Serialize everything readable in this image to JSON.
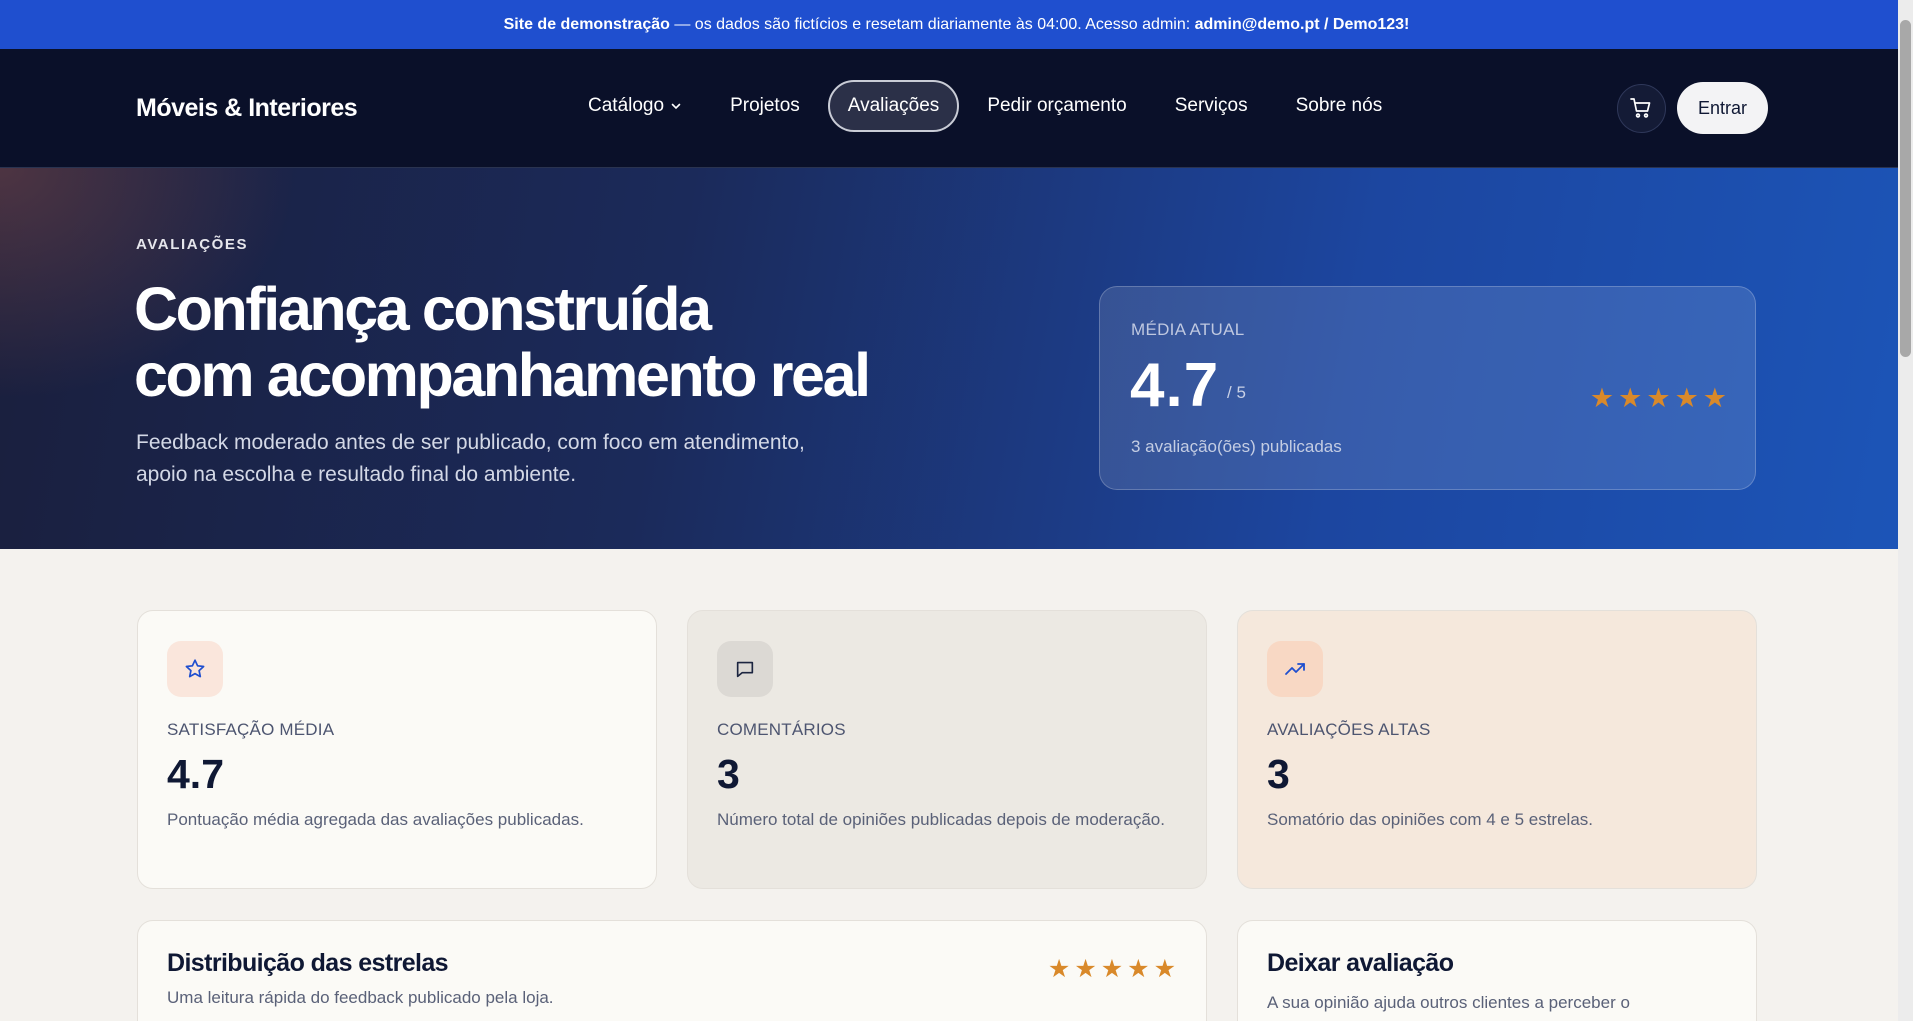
{
  "demo_bar": {
    "lead": "Site de demonstração",
    "text": " — os dados são fictícios e resetam diariamente às 04:00. Acesso admin: ",
    "credentials": "admin@demo.pt / Demo123!"
  },
  "header": {
    "brand": "Móveis & Interiores",
    "nav": [
      {
        "label": "Catálogo",
        "icon": "chevron-down-icon"
      },
      {
        "label": "Projetos"
      },
      {
        "label": "Avaliações",
        "active": true
      },
      {
        "label": "Pedir orçamento"
      },
      {
        "label": "Serviços"
      },
      {
        "label": "Sobre nós"
      }
    ],
    "cart_icon": "cart-icon",
    "login_label": "Entrar"
  },
  "hero": {
    "eyebrow": "AVALIAÇÕES",
    "title_line1": "Confiança construída",
    "title_line2": "com acompanhamento real",
    "subtitle_line1": "Feedback moderado antes de ser publicado, com foco em atendimento,",
    "subtitle_line2": "apoio na escolha e resultado final do ambiente.",
    "rating_card": {
      "label": "MÉDIA ATUAL",
      "value": "4.7",
      "of": "/ 5",
      "count_text": "3 avaliação(ões) publicadas",
      "stars": 5
    }
  },
  "stats": [
    {
      "icon": "star-icon",
      "label": "SATISFAÇÃO MÉDIA",
      "value": "4.7",
      "description": "Pontuação média agregada das avaliações publicadas."
    },
    {
      "icon": "comment-icon",
      "label": "COMENTÁRIOS",
      "value": "3",
      "description": "Número total de opiniões publicadas depois de moderação."
    },
    {
      "icon": "trending-up-icon",
      "label": "AVALIAÇÕES ALTAS",
      "value": "3",
      "description": "Somatório das opiniões com 4 e 5 estrelas."
    }
  ],
  "distribution": {
    "title": "Distribuição das estrelas",
    "subtitle": "Uma leitura rápida do feedback publicado pela loja.",
    "stars": 5
  },
  "leave_review": {
    "title": "Deixar avaliação",
    "subtitle": "A sua opinião ajuda outros clientes a perceber o"
  },
  "colors": {
    "demo_bar": "#1f4fcf",
    "header_bg": "#0a1029",
    "star": "#d9892a",
    "accent_blue": "#1c55b8"
  }
}
